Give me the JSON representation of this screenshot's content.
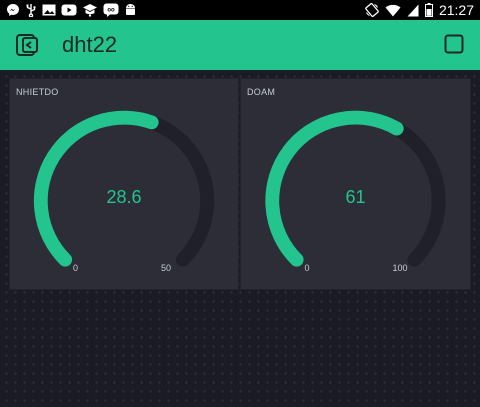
{
  "status_bar": {
    "time": "21:27",
    "icons": [
      "messenger-icon",
      "usb-icon",
      "image-icon",
      "youtube-icon",
      "graduation-cap-icon",
      "chat-bubble-icon",
      "android-icon",
      "screen-rotation-icon",
      "wifi-icon",
      "signal-icon",
      "battery-icon"
    ]
  },
  "header": {
    "title": "dht22",
    "back_icon": "device-back-icon",
    "play_icon": "play-square-icon"
  },
  "widgets": [
    {
      "label": "NHIETDO",
      "value": "28.6",
      "numeric_value": 28.6,
      "min": "0",
      "max": "50",
      "min_value": 0,
      "max_value": 50
    },
    {
      "label": "DOAM",
      "value": "61",
      "numeric_value": 61,
      "min": "0",
      "max": "100",
      "min_value": 0,
      "max_value": 100
    }
  ],
  "colors": {
    "accent": "#23c48e",
    "widget_bg": "#2c2d37",
    "track": "#1f2029",
    "background": "#1c1d26"
  }
}
